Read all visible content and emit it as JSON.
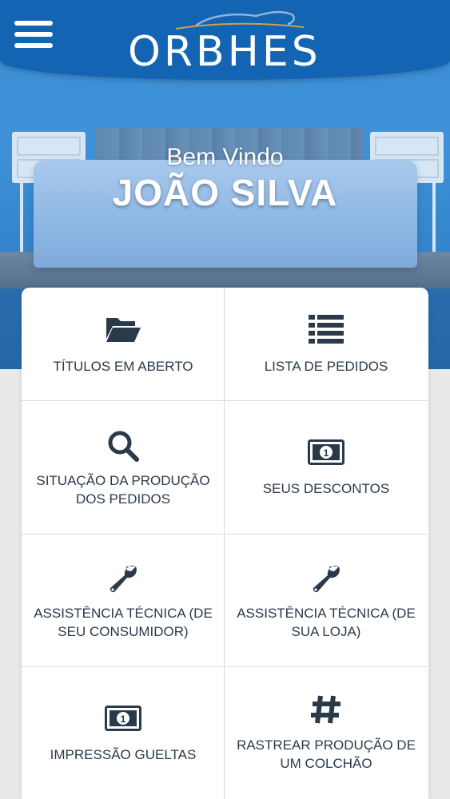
{
  "header": {
    "logo_text": "ORBHES",
    "menu_icon": "hamburger-menu-icon",
    "color": "#1464b4"
  },
  "welcome": {
    "greeting": "Bem Vindo",
    "user_name": "JOÃO SILVA"
  },
  "menu": {
    "items": [
      {
        "label": "TÍTULOS EM ABERTO",
        "icon": "folder-open-icon"
      },
      {
        "label": "LISTA DE PEDIDOS",
        "icon": "list-icon"
      },
      {
        "label": "SITUAÇÃO DA PRODUÇÃO DOS PEDIDOS",
        "icon": "search-icon"
      },
      {
        "label": "SEUS DESCONTOS",
        "icon": "money-bill-icon"
      },
      {
        "label": "ASSISTÊNCIA TÉCNICA (DE SEU CONSUMIDOR)",
        "icon": "wrench-icon"
      },
      {
        "label": "ASSISTÊNCIA TÉCNICA (DE SUA LOJA)",
        "icon": "wrench-icon"
      },
      {
        "label": "IMPRESSÃO GUELTAS",
        "icon": "money-bill-icon"
      },
      {
        "label": "RASTREAR PRODUÇÃO DE UM COLCHÃO",
        "icon": "hashtag-icon"
      }
    ]
  },
  "colors": {
    "icon": "#2b3a4a",
    "hero": "#2f86d2",
    "background": "#e9e9ea"
  }
}
